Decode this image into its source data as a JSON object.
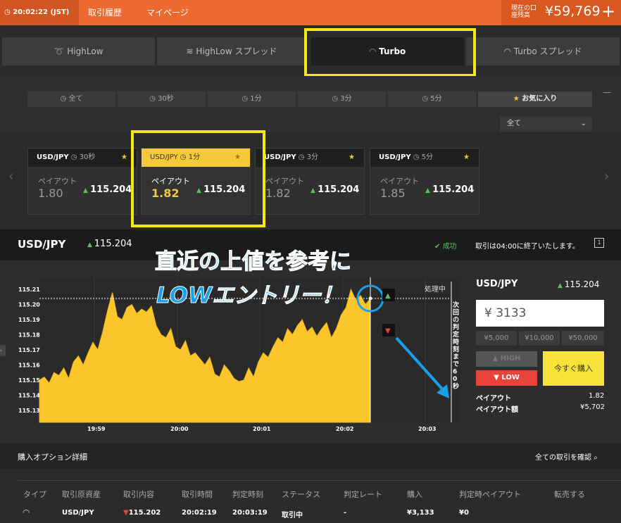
{
  "topbar": {
    "time": "20:02:22 (JST)",
    "nav_history": "取引履歴",
    "nav_mypage": "マイページ",
    "balance_label": "現在の口座残高",
    "balance": "¥59,769",
    "add_icon": "+"
  },
  "tabs": [
    "HighLow",
    "HighLow スプレッド",
    "Turbo",
    "Turbo スプレッド"
  ],
  "filters": {
    "items": [
      "全て",
      "30秒",
      "1分",
      "3分",
      "5分",
      "お気に入り"
    ],
    "select_value": "全て",
    "collapse": "—"
  },
  "cards": [
    {
      "pair": "USD/JPY",
      "period": "30秒",
      "payout_label": "ペイアウト",
      "payout": "1.80",
      "rate": "115.204"
    },
    {
      "pair": "USD/JPY",
      "period": "1分",
      "payout_label": "ペイアウト",
      "payout": "1.82",
      "rate": "115.204"
    },
    {
      "pair": "USD/JPY",
      "period": "3分",
      "payout_label": "ペイアウト",
      "payout": "1.82",
      "rate": "115.204"
    },
    {
      "pair": "USD/JPY",
      "period": "5分",
      "payout_label": "ペイアウト",
      "payout": "1.85",
      "rate": "115.204"
    }
  ],
  "chart_header": {
    "pair": "USD/JPY",
    "rate": "115.204",
    "status": "成功",
    "message": "取引は04:00に終了いたします。",
    "help": "1"
  },
  "chart_data": {
    "type": "area",
    "yticks": [
      "115.21",
      "115.20",
      "115.19",
      "115.18",
      "115.17",
      "115.16",
      "115.15",
      "115.14",
      "115.13"
    ],
    "ylim": [
      115.122,
      115.218
    ],
    "xticks": [
      "19:59",
      "20:00",
      "20:01",
      "20:02",
      "20:03"
    ],
    "current_rate": 115.204,
    "processing_label": "処理中",
    "countdown_label": "次回の判定時刻まで60秒",
    "values": [
      115.15,
      115.152,
      115.148,
      115.155,
      115.153,
      115.158,
      115.151,
      115.162,
      115.166,
      115.16,
      115.168,
      115.175,
      115.17,
      115.182,
      115.196,
      115.208,
      115.192,
      115.19,
      115.198,
      115.2,
      115.194,
      115.197,
      115.195,
      115.199,
      115.186,
      115.18,
      115.178,
      115.184,
      115.172,
      115.17,
      115.176,
      115.166,
      115.168,
      115.164,
      115.16,
      115.165,
      115.154,
      115.152,
      115.16,
      115.156,
      115.151,
      115.149,
      115.15,
      115.158,
      115.152,
      115.162,
      115.168,
      115.165,
      115.172,
      115.178,
      115.175,
      115.184,
      115.18,
      115.186,
      115.19,
      115.182,
      115.185,
      115.179,
      115.184,
      115.188,
      115.178,
      115.184,
      115.193,
      115.198,
      115.21,
      115.203,
      115.206,
      115.2,
      115.204
    ]
  },
  "annotation": {
    "line1": "直近の上値を参考に",
    "line2": "LOWエントリー！"
  },
  "trade_panel": {
    "pair": "USD/JPY",
    "rate": "115.204",
    "amount": "¥ 3133",
    "quick": [
      "¥5,000",
      "¥10,000",
      "¥50,000"
    ],
    "high": "HIGH",
    "low": "LOW",
    "buy": "今すぐ購入",
    "payout_label": "ペイアウト",
    "payout": "1.82",
    "payout_amount_label": "ペイアウト額",
    "payout_amount": "¥5,702"
  },
  "bottom": {
    "title": "購入オプション詳細",
    "link": "全ての取引を確認",
    "headers": [
      "タイプ",
      "取引原資産",
      "取引内容",
      "取引時間",
      "判定時刻",
      "ステータス",
      "判定レート",
      "購入",
      "判定時ペイアウト",
      "転売する"
    ],
    "row": [
      "USD/JPY",
      "115.202",
      "20:02:19",
      "20:03:19",
      "取引中",
      "-",
      "¥3,133",
      "¥0"
    ]
  },
  "colors": {
    "accent": "#ec6a30",
    "highlight": "#f5e619",
    "area": "#fcc52c",
    "low": "#e8433a",
    "annotation": "#1aa0e8"
  }
}
